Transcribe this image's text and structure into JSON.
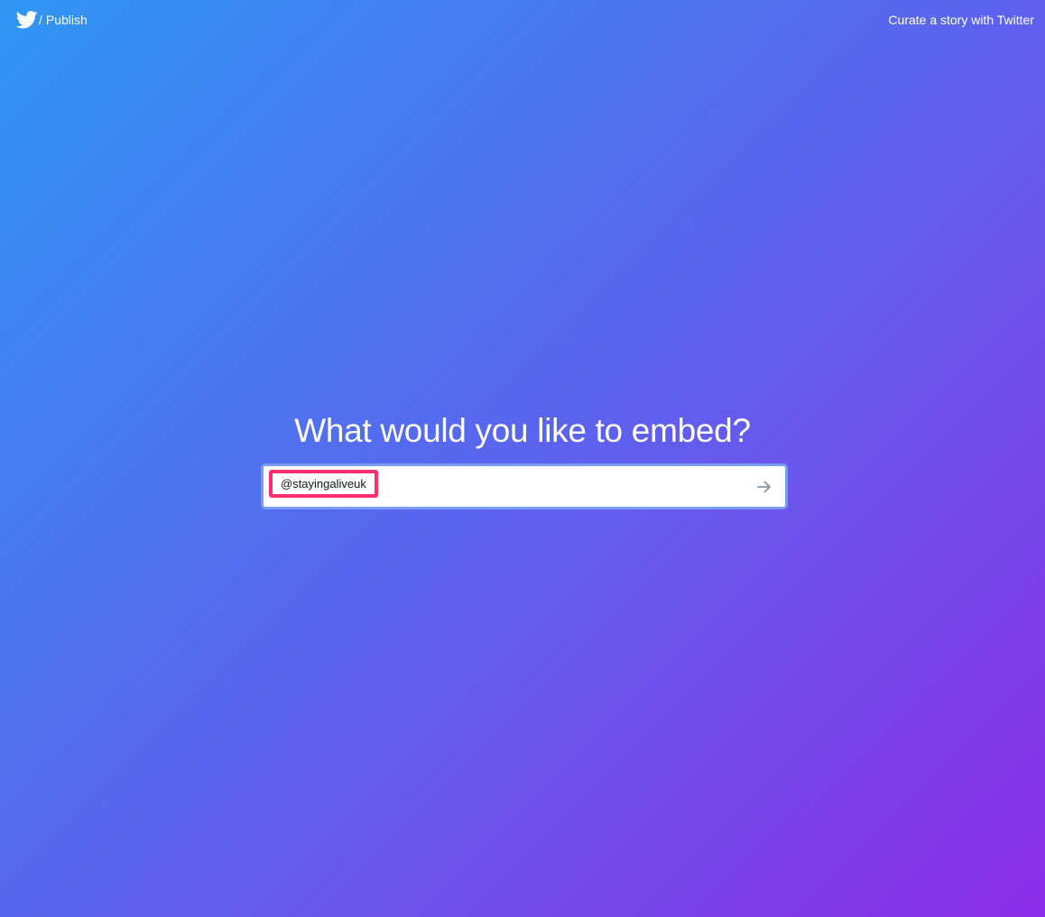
{
  "header": {
    "brand": {
      "icon": "twitter-bird-icon",
      "separator": "/",
      "label": "Publish"
    },
    "curate_link": "Curate a story with Twitter"
  },
  "main": {
    "headline": "What would you like to embed?",
    "search": {
      "token": "@stayingaliveuk",
      "value": "",
      "submit_icon": "arrow-right-icon"
    }
  },
  "colors": {
    "gradient_start": "#2f96f2",
    "gradient_end": "#8b2ce8",
    "token_border": "#ff2e6e",
    "input_border": "#7b9cf5",
    "arrow": "#8899a6"
  }
}
